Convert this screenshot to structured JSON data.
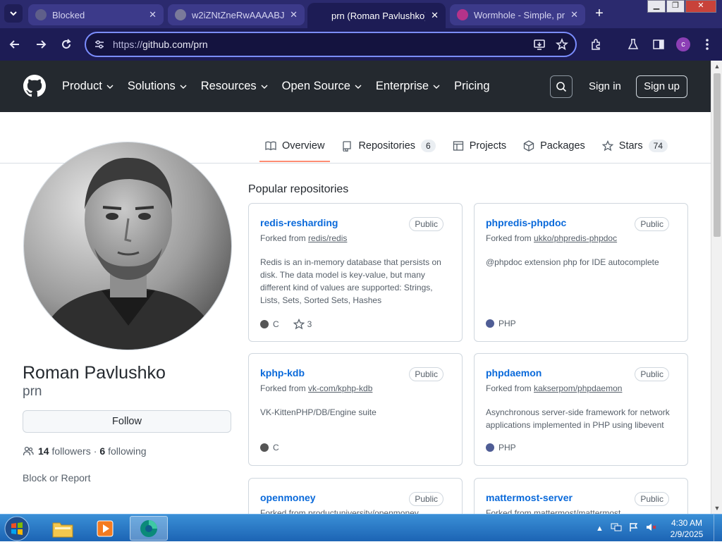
{
  "browser": {
    "tabs": [
      {
        "label": "Blocked",
        "active": false,
        "favicon_color": "#5f5f8a"
      },
      {
        "label": "w2iZNtZneRwAAAABJ",
        "active": false,
        "favicon_color": "#7a7a9a"
      },
      {
        "label": "prn (Roman Pavlushko)",
        "active": true,
        "favicon_color": "#1d1c55"
      },
      {
        "label": "Wormhole - Simple, pr",
        "active": false,
        "favicon_color": "#b5338a"
      }
    ],
    "new_tab": "+",
    "url_scheme": "https://",
    "url_rest": "github.com/prn",
    "profile_initial": "c"
  },
  "github_header": {
    "nav": [
      {
        "label": "Product",
        "has_chevron": true
      },
      {
        "label": "Solutions",
        "has_chevron": true
      },
      {
        "label": "Resources",
        "has_chevron": true
      },
      {
        "label": "Open Source",
        "has_chevron": true
      },
      {
        "label": "Enterprise",
        "has_chevron": true
      },
      {
        "label": "Pricing",
        "has_chevron": false
      }
    ],
    "sign_in": "Sign in",
    "sign_up": "Sign up"
  },
  "profile_tabs": [
    {
      "label": "Overview",
      "icon": "book-icon",
      "counter": null,
      "selected": true
    },
    {
      "label": "Repositories",
      "icon": "repo-icon",
      "counter": "6",
      "selected": false
    },
    {
      "label": "Projects",
      "icon": "table-icon",
      "counter": null,
      "selected": false
    },
    {
      "label": "Packages",
      "icon": "package-icon",
      "counter": null,
      "selected": false
    },
    {
      "label": "Stars",
      "icon": "star-icon",
      "counter": "74",
      "selected": false
    }
  ],
  "profile": {
    "full_name": "Roman Pavlushko",
    "login": "prn",
    "follow_label": "Follow",
    "followers_count": "14",
    "followers_label": "followers",
    "separator": "·",
    "following_count": "6",
    "following_label": "following",
    "block_report": "Block or Report"
  },
  "popular": {
    "title": "Popular repositories",
    "repos": [
      {
        "name": "redis-resharding",
        "visibility": "Public",
        "forked_prefix": "Forked from",
        "forked_from": "redis/redis",
        "description": "Redis is an in-memory database that persists on disk. The data model is key-value, but many different kind of values are supported: Strings, Lists, Sets, Sorted Sets, Hashes",
        "language": "C",
        "lang_color": "#555555",
        "stars": "3"
      },
      {
        "name": "phpredis-phpdoc",
        "visibility": "Public",
        "forked_prefix": "Forked from",
        "forked_from": "ukko/phpredis-phpdoc",
        "description": "@phpdoc extension php for IDE autocomplete",
        "language": "PHP",
        "lang_color": "#4F5D95",
        "stars": null
      },
      {
        "name": "kphp-kdb",
        "visibility": "Public",
        "forked_prefix": "Forked from",
        "forked_from": "vk-com/kphp-kdb",
        "description": "VK-KittenPHP/DB/Engine suite",
        "language": "C",
        "lang_color": "#555555",
        "stars": null
      },
      {
        "name": "phpdaemon",
        "visibility": "Public",
        "forked_prefix": "Forked from",
        "forked_from": "kakserpom/phpdaemon",
        "description": "Asynchronous server-side framework for network applications implemented in PHP using libevent",
        "language": "PHP",
        "lang_color": "#4F5D95",
        "stars": null
      },
      {
        "name": "openmoney",
        "visibility": "Public",
        "forked_prefix": "Forked from",
        "forked_from": "productuniversity/openmoney",
        "description": "",
        "language": null,
        "lang_color": null,
        "stars": null
      },
      {
        "name": "mattermost-server",
        "visibility": "Public",
        "forked_prefix": "Forked from",
        "forked_from": "mattermost/mattermost",
        "description": "",
        "language": null,
        "lang_color": null,
        "stars": null
      }
    ]
  },
  "taskbar": {
    "time": "4:30 AM",
    "date": "2/9/2025"
  },
  "colors": {
    "github_dark": "#24292f",
    "link_blue": "#0969da",
    "tab_underline": "#fd8c73",
    "chrome_bg": "#1d1c55"
  }
}
